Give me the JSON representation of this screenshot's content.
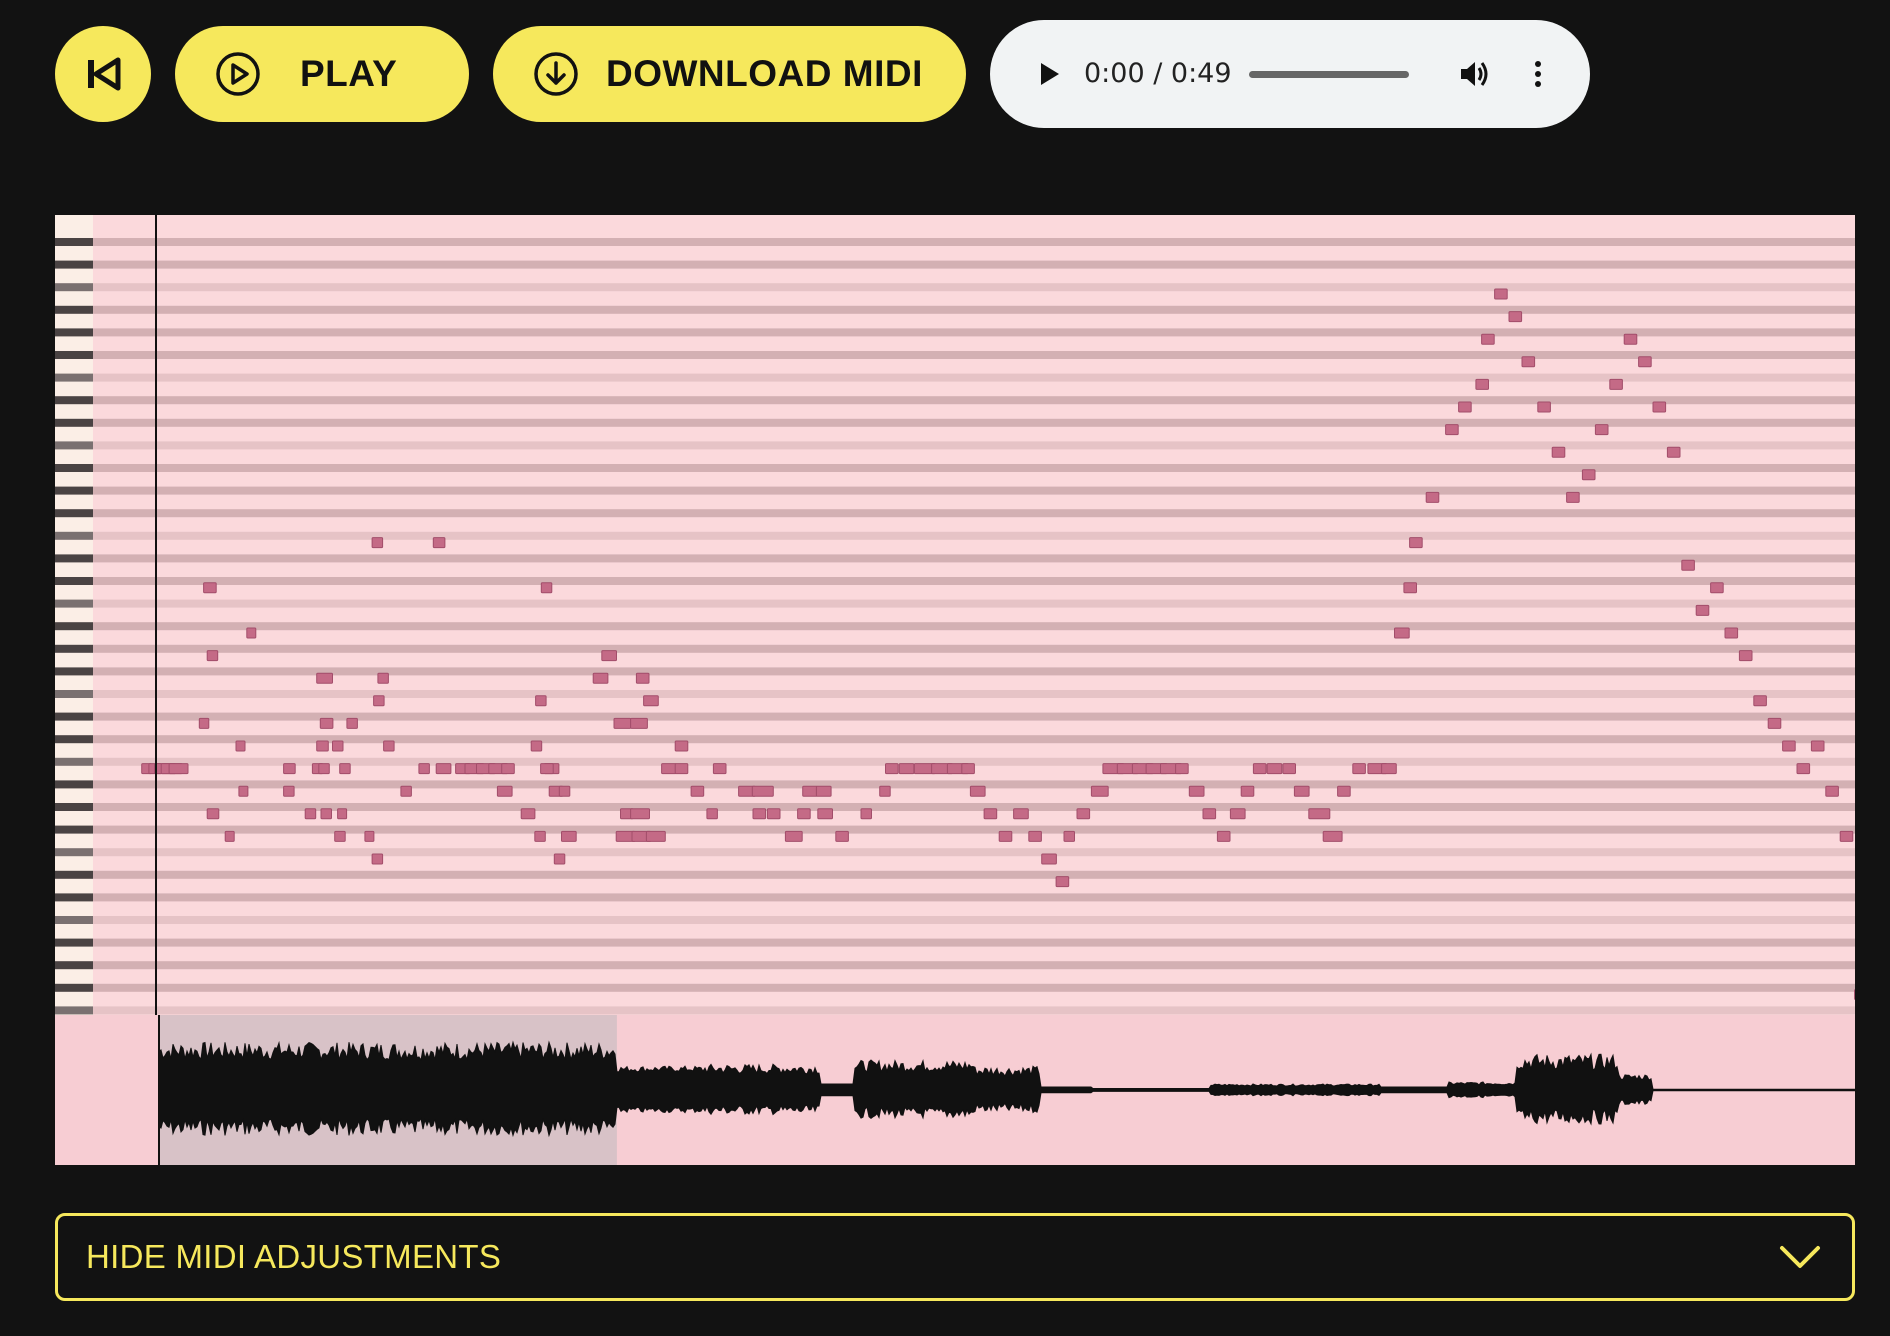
{
  "toolbar": {
    "restart_icon": "skip-to-start-icon",
    "play_label": "PLAY",
    "play_icon": "play-circle-icon",
    "download_label": "DOWNLOAD MIDI",
    "download_icon": "download-circle-icon",
    "accent_color": "#f6e85c"
  },
  "audio_player": {
    "time": "0:00 / 0:49",
    "progress": 0,
    "play_icon": "play-icon",
    "volume_icon": "volume-icon",
    "menu_icon": "more-vertical-icon"
  },
  "piano_roll": {
    "background_color": "#fbd9dc",
    "note_color": "#c46a86",
    "playhead_position": 0,
    "rows": 35,
    "notes": [
      [
        21,
        51,
        9
      ],
      [
        21,
        61,
        12
      ],
      [
        21,
        69,
        20
      ],
      [
        21,
        78,
        20
      ],
      [
        21,
        89,
        18
      ],
      [
        19,
        131,
        9
      ],
      [
        13,
        137,
        12
      ],
      [
        23,
        142,
        11
      ],
      [
        16,
        142,
        10
      ],
      [
        24,
        167,
        8
      ],
      [
        22,
        186,
        8
      ],
      [
        20,
        182,
        8
      ],
      [
        15,
        197,
        8
      ],
      [
        22,
        248,
        10
      ],
      [
        21,
        248,
        11
      ],
      [
        23,
        278,
        10
      ],
      [
        21,
        288,
        10
      ],
      [
        21,
        297,
        10
      ],
      [
        20,
        294,
        11
      ],
      [
        19,
        299,
        12
      ],
      [
        17,
        294,
        15
      ],
      [
        23,
        300,
        10
      ],
      [
        24,
        319,
        10
      ],
      [
        23,
        323,
        8
      ],
      [
        20,
        316,
        10
      ],
      [
        19,
        336,
        10
      ],
      [
        21,
        326,
        10
      ],
      [
        18,
        373,
        10
      ],
      [
        20,
        387,
        10
      ],
      [
        22,
        411,
        10
      ],
      [
        21,
        436,
        10
      ],
      [
        25,
        371,
        10
      ],
      [
        24,
        361,
        8
      ],
      [
        11,
        371,
        10
      ],
      [
        17,
        379,
        10
      ],
      [
        11,
        456,
        11
      ],
      [
        21,
        460,
        14
      ],
      [
        21,
        487,
        14
      ],
      [
        21,
        500,
        18
      ],
      [
        21,
        516,
        18
      ],
      [
        21,
        533,
        18
      ],
      [
        21,
        551,
        12
      ],
      [
        22,
        545,
        14
      ],
      [
        23,
        578,
        13
      ],
      [
        24,
        597,
        10
      ],
      [
        21,
        610,
        14
      ],
      [
        20,
        592,
        10
      ],
      [
        21,
        605,
        12
      ],
      [
        18,
        598,
        10
      ],
      [
        13,
        606,
        10
      ],
      [
        22,
        617,
        13
      ],
      [
        22,
        631,
        10
      ],
      [
        25,
        624,
        10
      ],
      [
        24,
        634,
        14
      ],
      [
        16,
        690,
        14
      ],
      [
        17,
        678,
        14
      ],
      [
        19,
        707,
        16
      ],
      [
        19,
        730,
        16
      ],
      [
        23,
        716,
        12
      ],
      [
        23,
        730,
        18
      ],
      [
        24,
        710,
        18
      ],
      [
        24,
        732,
        18
      ],
      [
        24,
        752,
        18
      ],
      [
        17,
        738,
        12
      ],
      [
        18,
        748,
        14
      ],
      [
        21,
        773,
        14
      ],
      [
        21,
        792,
        12
      ],
      [
        20,
        792,
        12
      ],
      [
        22,
        814,
        12
      ],
      [
        23,
        836,
        10
      ],
      [
        21,
        845,
        12
      ],
      [
        22,
        880,
        16
      ],
      [
        22,
        899,
        20
      ],
      [
        23,
        900,
        12
      ],
      [
        23,
        920,
        12
      ],
      [
        24,
        945,
        16
      ],
      [
        23,
        962,
        12
      ],
      [
        22,
        969,
        14
      ],
      [
        22,
        988,
        14
      ],
      [
        23,
        990,
        14
      ],
      [
        24,
        1015,
        12
      ],
      [
        23,
        1050,
        10
      ],
      [
        22,
        1076,
        10
      ],
      [
        21,
        1084,
        12
      ],
      [
        21,
        1103,
        14
      ],
      [
        21,
        1124,
        20
      ],
      [
        21,
        1148,
        20
      ],
      [
        21,
        1170,
        20
      ],
      [
        21,
        1190,
        12
      ],
      [
        22,
        1202,
        14
      ],
      [
        23,
        1221,
        12
      ],
      [
        24,
        1242,
        12
      ],
      [
        23,
        1262,
        14
      ],
      [
        24,
        1283,
        12
      ],
      [
        25,
        1301,
        14
      ],
      [
        26,
        1321,
        12
      ],
      [
        24,
        1332,
        10
      ],
      [
        23,
        1350,
        12
      ],
      [
        22,
        1370,
        16
      ],
      [
        21,
        1386,
        20
      ],
      [
        21,
        1406,
        20
      ],
      [
        21,
        1427,
        20
      ],
      [
        21,
        1446,
        20
      ],
      [
        21,
        1466,
        20
      ],
      [
        21,
        1487,
        12
      ],
      [
        22,
        1506,
        14
      ],
      [
        23,
        1525,
        12
      ],
      [
        24,
        1545,
        12
      ],
      [
        23,
        1563,
        14
      ],
      [
        22,
        1578,
        12
      ],
      [
        21,
        1595,
        12
      ],
      [
        21,
        1614,
        14
      ],
      [
        21,
        1636,
        12
      ],
      [
        22,
        1652,
        14
      ],
      [
        23,
        1672,
        20
      ],
      [
        24,
        1692,
        18
      ],
      [
        22,
        1712,
        12
      ],
      [
        21,
        1733,
        12
      ],
      [
        21,
        1754,
        18
      ],
      [
        21,
        1773,
        14
      ],
      [
        15,
        1791,
        14
      ],
      [
        13,
        1804,
        12
      ],
      [
        11,
        1812,
        12
      ],
      [
        9,
        1835,
        12
      ],
      [
        6,
        1862,
        12
      ],
      [
        5,
        1880,
        12
      ],
      [
        4,
        1904,
        12
      ],
      [
        2,
        1912,
        12
      ],
      [
        0,
        1930,
        12
      ],
      [
        1,
        1950,
        12
      ],
      [
        3,
        1968,
        12
      ],
      [
        5,
        1990,
        12
      ],
      [
        7,
        2010,
        12
      ],
      [
        9,
        2030,
        12
      ],
      [
        8,
        2052,
        12
      ],
      [
        6,
        2070,
        12
      ],
      [
        4,
        2090,
        12
      ],
      [
        2,
        2110,
        12
      ],
      [
        3,
        2130,
        12
      ],
      [
        5,
        2150,
        12
      ],
      [
        7,
        2170,
        12
      ],
      [
        12,
        2190,
        12
      ],
      [
        14,
        2210,
        12
      ],
      [
        13,
        2230,
        12
      ],
      [
        15,
        2250,
        12
      ],
      [
        16,
        2270,
        12
      ],
      [
        18,
        2290,
        12
      ],
      [
        19,
        2310,
        12
      ],
      [
        20,
        2330,
        12
      ],
      [
        21,
        2350,
        12
      ],
      [
        20,
        2370,
        12
      ],
      [
        22,
        2390,
        12
      ],
      [
        24,
        2410,
        12
      ],
      [
        31,
        2430,
        12
      ],
      [
        32,
        2450,
        12
      ],
      [
        30,
        2470,
        12
      ],
      [
        29,
        2490,
        12
      ],
      [
        28,
        2510,
        12
      ],
      [
        26,
        2530,
        12
      ],
      [
        25,
        2550,
        12
      ],
      [
        26,
        2570,
        12
      ]
    ]
  },
  "waveform": {
    "background_color": "#f7cdd3",
    "selection_color": "#d8c2c7",
    "selection_end": 0.27,
    "playhead_position": 0
  },
  "midi_panel": {
    "toggle_label": "HIDE MIDI ADJUSTMENTS",
    "toggle_icon": "chevron-down-icon"
  }
}
